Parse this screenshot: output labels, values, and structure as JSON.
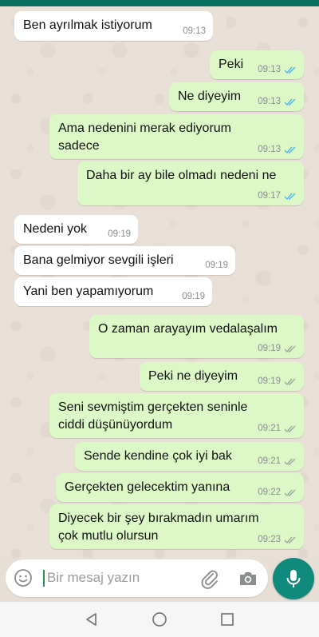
{
  "messages": [
    {
      "text": "Ben ayrılmak istiyorum",
      "time": "09:13",
      "dir": "in"
    },
    {
      "text": "Peki",
      "time": "09:13",
      "dir": "out",
      "status": "read"
    },
    {
      "text": "Ne diyeyim",
      "time": "09:13",
      "dir": "out",
      "status": "read"
    },
    {
      "text": "Ama nedenini merak ediyorum",
      "text2": "sadece",
      "time": "09:13",
      "dir": "out",
      "status": "read"
    },
    {
      "text": "Daha bir ay bile olmadı nedeni ne",
      "time": "09:17",
      "dir": "out",
      "status": "read"
    },
    {
      "text": "Nedeni yok",
      "time": "09:19",
      "dir": "in"
    },
    {
      "text": "Bana gelmiyor sevgili işleri",
      "time": "09:19",
      "dir": "in"
    },
    {
      "text": "Yani ben yapamıyorum",
      "time": "09:19",
      "dir": "in"
    },
    {
      "text": "O zaman arayayım vedalaşalım",
      "time": "09:19",
      "dir": "out",
      "status": "sent"
    },
    {
      "text": "Peki ne diyeyim",
      "time": "09:19",
      "dir": "out",
      "status": "sent"
    },
    {
      "text": "Seni sevmiştim gerçekten seninle",
      "text2": "ciddi düşünüyordum",
      "time": "09:21",
      "dir": "out",
      "status": "sent"
    },
    {
      "text": "Sende kendine çok iyi bak",
      "time": "09:21",
      "dir": "out",
      "status": "sent"
    },
    {
      "text": "Gerçekten gelecektim yanına",
      "time": "09:22",
      "dir": "out",
      "status": "sent"
    },
    {
      "text": "Diyecek bir şey bırakmadın umarım",
      "text2": "çok mutlu olursun",
      "time": "09:23",
      "dir": "out",
      "status": "sent"
    }
  ],
  "input": {
    "placeholder": "Bir mesaj yazın"
  },
  "colors": {
    "incoming": "#ffffff",
    "outgoing": "#dcf8c6",
    "accent": "#0f8a7d",
    "read_ticks": "#4fb6ec"
  },
  "icons": {
    "emoji": "emoji-icon",
    "attach": "paperclip-icon",
    "camera": "camera-icon",
    "mic": "mic-icon",
    "back": "back-triangle-icon",
    "home": "home-circle-icon",
    "recents": "recents-square-icon"
  }
}
